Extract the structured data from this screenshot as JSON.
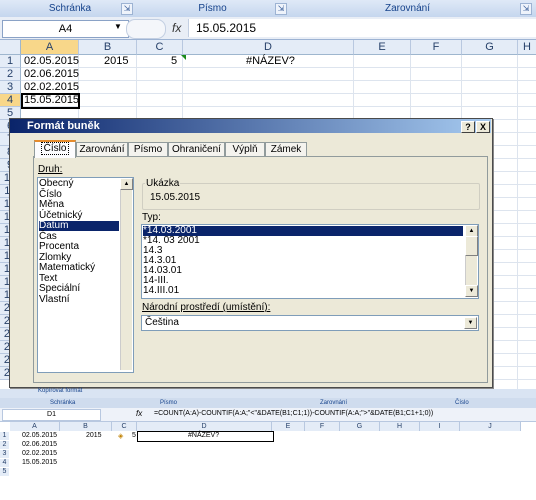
{
  "ribbon": {
    "groups": [
      "Schránka",
      "Písmo",
      "Zarovnání"
    ]
  },
  "formula_bar": {
    "name_box": "A4",
    "fx": "fx",
    "formula": "15.05.2015"
  },
  "columns": [
    "A",
    "B",
    "C",
    "D",
    "E",
    "F",
    "G",
    "H"
  ],
  "rows": [
    "1",
    "2",
    "3",
    "4",
    "5",
    "6",
    "7",
    "8",
    "9",
    "10",
    "11",
    "12",
    "13",
    "14",
    "15",
    "16",
    "17",
    "18",
    "19",
    "20",
    "21",
    "22",
    "23",
    "24",
    "25"
  ],
  "cells": {
    "a1": "02.05.2015",
    "b1": "2015",
    "c1": "5",
    "d1": "#NÁZEV?",
    "a2": "02.06.2015",
    "a3": "02.02.2015",
    "a4": "15.05.2015"
  },
  "dialog": {
    "title": "Formát buněk",
    "help": "?",
    "close": "X",
    "tabs": [
      "Číslo",
      "Zarovnání",
      "Písmo",
      "Ohraničení",
      "Výplň",
      "Zámek"
    ],
    "category_label": "Druh:",
    "categories": [
      "Obecný",
      "Číslo",
      "Měna",
      "Účetnický",
      "Datum",
      "Čas",
      "Procenta",
      "Zlomky",
      "Matematický",
      "Text",
      "Speciální",
      "Vlastní"
    ],
    "selected_category": "Datum",
    "sample_label": "Ukázka",
    "sample_value": "15.05.2015",
    "type_label": "Typ:",
    "types": [
      "*14.03.2001",
      "*14. 03 2001",
      "14.3",
      "14.3.01",
      "14.03.01",
      "14-III.",
      "14.III.01"
    ],
    "locale_label": "Národní prostředí (umístění):",
    "locale_value": "Čeština"
  },
  "lower": {
    "copy_format": "Kopírovat formát",
    "groups": [
      "Schránka",
      "Písmo",
      "Zarovnání",
      "Číslo"
    ],
    "name_box": "D1",
    "fx": "fx",
    "formula": "=COUNT(A:A)-COUNTIF(A:A;\"<\"&DATE(B1;C1;1))-COUNTIF(A:A;\">\"&DATE(B1;C1+1;0))",
    "columns": [
      "A",
      "B",
      "C",
      "D",
      "E",
      "F",
      "G",
      "H",
      "I",
      "J"
    ],
    "rows": [
      "1",
      "2",
      "3",
      "4",
      "5"
    ],
    "a1": "02.05.2015",
    "b1": "2015",
    "c1": "5",
    "d1": "#NÁZEV?",
    "a2": "02.06.2015",
    "a3": "02.02.2015",
    "a4": "15.05.2015"
  }
}
